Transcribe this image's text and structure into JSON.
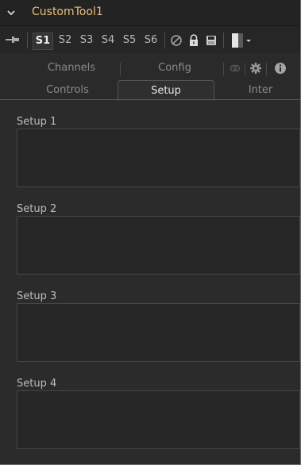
{
  "header": {
    "title": "CustomTool1"
  },
  "toolbar": {
    "slots": [
      "S1",
      "S2",
      "S3",
      "S4",
      "S5",
      "S6"
    ],
    "active_slot": "S1"
  },
  "tabs": {
    "row1": [
      "Channels",
      "Config"
    ],
    "row2": [
      "Controls",
      "Setup",
      "Inter"
    ],
    "active": "Setup"
  },
  "sections": [
    {
      "label": "Setup 1"
    },
    {
      "label": "Setup 2"
    },
    {
      "label": "Setup 3"
    },
    {
      "label": "Setup 4"
    }
  ],
  "colors": {
    "accent": "#e8c07a",
    "background": "#2b2b2b",
    "panel": "#262626"
  }
}
